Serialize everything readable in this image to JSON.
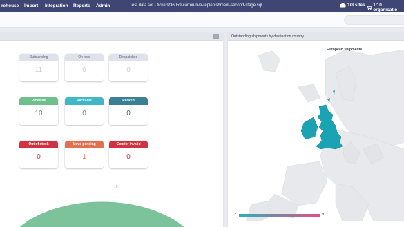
{
  "nav": {
    "items": [
      "rehouse",
      "Import",
      "Integration",
      "Reports",
      "Admin"
    ],
    "dataset_title": "Test data set - tickets/36059-carton-live-replenishment-second-stage.sql",
    "sites": "1/8 sites",
    "organisations": "1/10 organisatio"
  },
  "left_panel": {
    "tiles": [
      {
        "label": "Outstanding",
        "value": "11",
        "color": "grey"
      },
      {
        "label": "On hold",
        "value": "0",
        "color": "grey"
      },
      {
        "label": "Despatched",
        "value": "0",
        "color": "grey"
      },
      {
        "label": "Pickable",
        "value": "10",
        "color": "green"
      },
      {
        "label": "Packable",
        "value": "0",
        "color": "teal"
      },
      {
        "label": "Packed",
        "value": "0",
        "color": "blue"
      },
      {
        "label": "Out of stock",
        "value": "0",
        "color": "red"
      },
      {
        "label": "Move pending",
        "value": "1",
        "color": "orange"
      },
      {
        "label": "Courier invalid",
        "value": "0",
        "color": "red"
      }
    ],
    "gauge_label": "10"
  },
  "right_panel": {
    "title": "Outstanding shipments by destination country",
    "map_title": "European shipments",
    "scale_min": "2",
    "scale_max": "9"
  },
  "colors": {
    "nav_bg": "#3f4673",
    "gauge_green": "#7cc29a",
    "scale_start": "#2ab0bd",
    "scale_end": "#e14e8a",
    "uk_fill": "#1aa3b2"
  }
}
